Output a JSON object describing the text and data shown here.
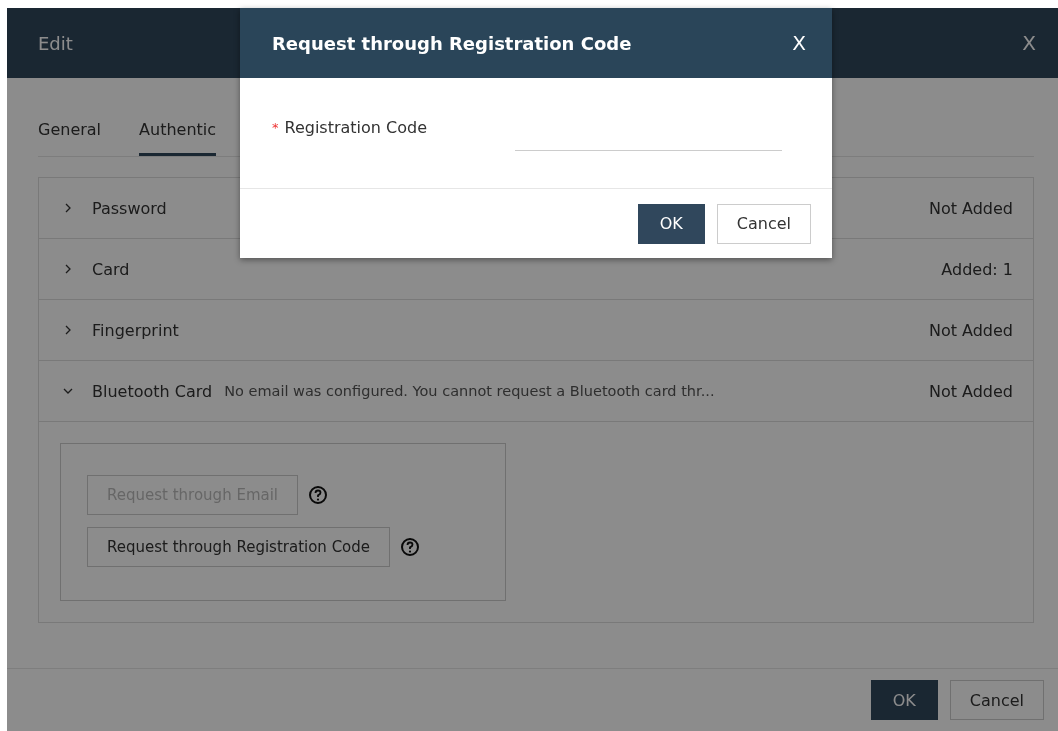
{
  "edit_dialog": {
    "title": "Edit",
    "close": "X",
    "tabs": [
      {
        "label": "General",
        "selected": false
      },
      {
        "label": "Authentic",
        "selected": true
      }
    ],
    "sections": [
      {
        "title": "Password",
        "status": "Not Added",
        "expanded": false
      },
      {
        "title": "Card",
        "status": "Added: 1",
        "expanded": false
      },
      {
        "title": "Fingerprint",
        "status": "Not Added",
        "expanded": false
      },
      {
        "title": "Bluetooth Card",
        "note": "No email was configured. You cannot request a Bluetooth card thr...",
        "status": "Not Added",
        "expanded": true,
        "actions": [
          {
            "label": "Request through Email",
            "disabled": true
          },
          {
            "label": "Request through Registration Code",
            "disabled": false
          }
        ]
      }
    ],
    "buttons": [
      {
        "label": "OK",
        "kind": "primary"
      },
      {
        "label": "Cancel",
        "kind": "secondary"
      }
    ]
  },
  "modal": {
    "title": "Request through Registration Code",
    "close": "X",
    "field": {
      "label": "Registration Code",
      "required_mark": "*"
    },
    "buttons": [
      {
        "label": "OK",
        "kind": "primary"
      },
      {
        "label": "Cancel",
        "kind": "secondary"
      }
    ]
  }
}
